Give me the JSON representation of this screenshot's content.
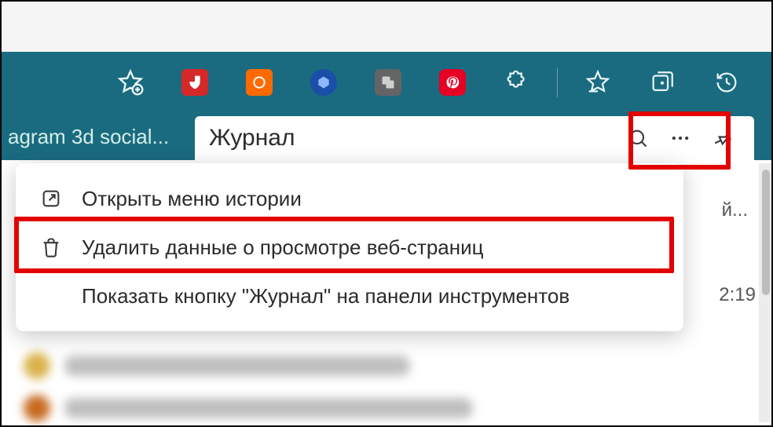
{
  "toolbar": {
    "icons": {
      "add_favorite": "add-favorite-icon",
      "ublock": "ublock-icon",
      "opera": "opera-icon",
      "metamask": "metamask-icon",
      "translator": "translator-icon",
      "pinterest": "pinterest-icon",
      "extensions": "extensions-icon",
      "favorites": "favorites-icon",
      "collections": "collections-icon",
      "history": "history-icon"
    }
  },
  "bookmarks": {
    "item0": "agram 3d social..."
  },
  "history_panel": {
    "title": "Журнал",
    "search": "search-icon",
    "more": "more-icon",
    "pin": "pin-icon",
    "side_text_fragment": "й...",
    "time": "2:19"
  },
  "menu": {
    "open_history": "Открыть меню истории",
    "clear_browsing": "Удалить данные о просмотре веб-страниц",
    "show_button": "Показать кнопку \"Журнал\" на панели инструментов"
  }
}
